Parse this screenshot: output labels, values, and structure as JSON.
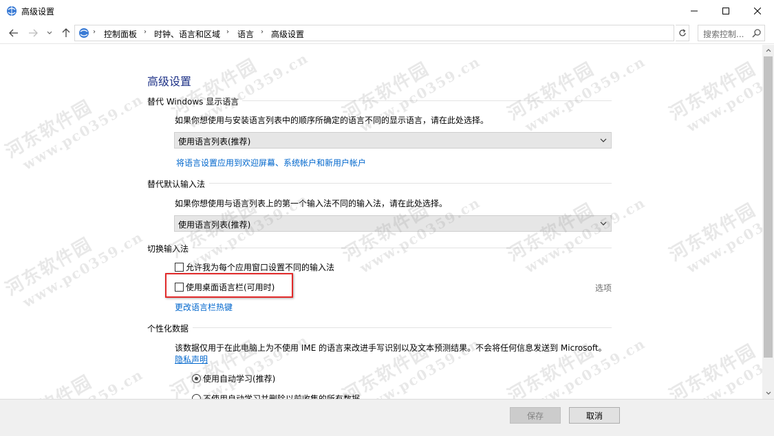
{
  "window": {
    "title": "高级设置"
  },
  "address": {
    "crumbs": [
      "控制面板",
      "时钟、语言和区域",
      "语言",
      "高级设置"
    ],
    "search_placeholder": "搜索控制..."
  },
  "content": {
    "page_title": "高级设置",
    "display_language": {
      "section_title": "替代 Windows 显示语言",
      "description": "如果你想使用与安装语言列表中的顺序所确定的语言不同的显示语言，请在此处选择。",
      "select_value": "使用语言列表(推荐)",
      "apply_link": "将语言设置应用到欢迎屏幕、系统帐户和新用户帐户"
    },
    "input_method": {
      "section_title": "替代默认输入法",
      "description": "如果你想使用与语言列表上的第一个输入法不同的输入法，请在此处选择。",
      "select_value": "使用语言列表(推荐)"
    },
    "switching": {
      "section_title": "切换输入法",
      "per_app_label": "允许我为每个应用窗口设置不同的输入法",
      "per_app_checked": false,
      "desktop_bar_label": "使用桌面语言栏(可用时)",
      "desktop_bar_checked": false,
      "options_link": "选项",
      "hotkeys_link": "更改语言栏热键"
    },
    "personalization": {
      "section_title": "个性化数据",
      "description": "该数据仅用于在此电脑上为不使用 IME 的语言来改进手写识别以及文本预测结果。不会将任何信息发送到 Microsoft。",
      "privacy_link": "隐私声明",
      "radio_auto": "使用自动学习(推荐)",
      "radio_auto_selected": true,
      "radio_no_auto": "不使用自动学习并删除以前收集的所有数据",
      "radio_no_auto_selected": false
    }
  },
  "footer": {
    "save_label": "保存",
    "cancel_label": "取消"
  },
  "watermark": {
    "cn": "河东软件园",
    "url": "www.pc0359.cn"
  },
  "colors": {
    "title_blue": "#1e3287",
    "link_blue": "#0066cc",
    "highlight_red": "#e22a2a"
  }
}
